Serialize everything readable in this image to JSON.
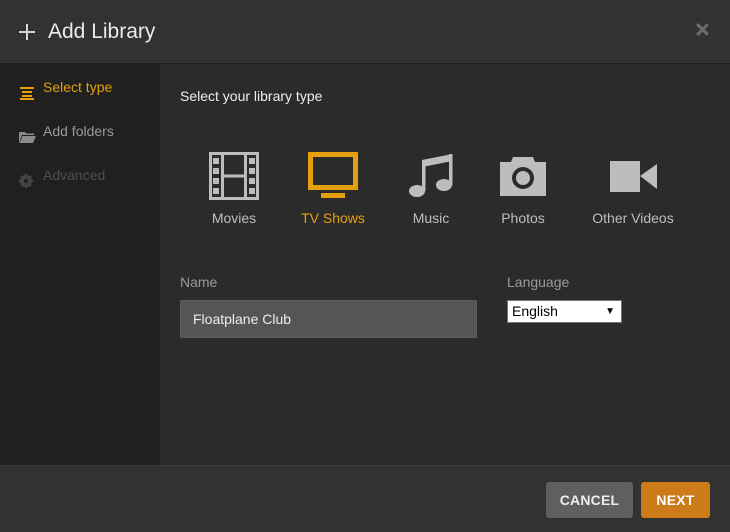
{
  "dialog": {
    "title": "Add Library"
  },
  "sidebar": {
    "items": [
      {
        "label": "Select type",
        "icon": "list-icon",
        "state": "active"
      },
      {
        "label": "Add folders",
        "icon": "folder-icon",
        "state": "enabled"
      },
      {
        "label": "Advanced",
        "icon": "gear-icon",
        "state": "disabled"
      }
    ]
  },
  "main": {
    "heading": "Select your library type",
    "types": [
      {
        "label": "Movies",
        "icon": "film-icon",
        "selected": false
      },
      {
        "label": "TV Shows",
        "icon": "tv-icon",
        "selected": true
      },
      {
        "label": "Music",
        "icon": "music-note-icon",
        "selected": false
      },
      {
        "label": "Photos",
        "icon": "camera-icon",
        "selected": false
      },
      {
        "label": "Other Videos",
        "icon": "video-camera-icon",
        "selected": false
      }
    ],
    "name_label": "Name",
    "name_value": "Floatplane Club",
    "language_label": "Language",
    "language_value": "English"
  },
  "footer": {
    "cancel_label": "CANCEL",
    "next_label": "NEXT"
  },
  "colors": {
    "accent": "#e5a00d",
    "next_button": "#cc7b19",
    "cancel_button": "#5f5f5f",
    "background": "#2b2b2b"
  }
}
